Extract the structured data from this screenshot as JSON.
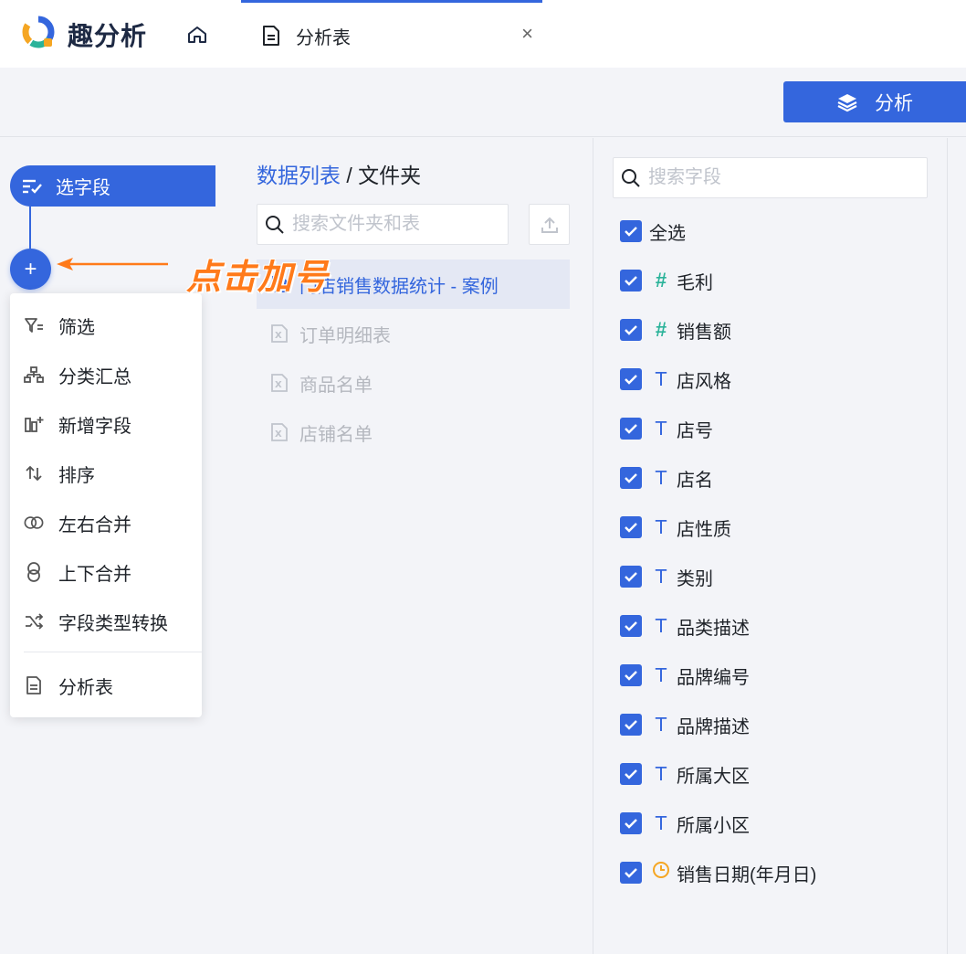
{
  "app": {
    "brand_name": "趣分析",
    "tab_label": "分析表",
    "tab_close": "×"
  },
  "toolbar": {
    "analyze_label": "分析"
  },
  "steps": {
    "select_field_label": "选字段",
    "plus_label": "+",
    "hint_text": "点击加号"
  },
  "menu": {
    "items": [
      {
        "label": "筛选",
        "icon": "filter-icon"
      },
      {
        "label": "分类汇总",
        "icon": "hierarchy-icon"
      },
      {
        "label": "新增字段",
        "icon": "add-column-icon"
      },
      {
        "label": "排序",
        "icon": "sort-icon"
      },
      {
        "label": "左右合并",
        "icon": "horizontal-merge-icon"
      },
      {
        "label": "上下合并",
        "icon": "vertical-merge-icon"
      },
      {
        "label": "字段类型转换",
        "icon": "shuffle-icon"
      }
    ],
    "bottom_item": {
      "label": "分析表",
      "icon": "document-icon"
    }
  },
  "datalist": {
    "breadcrumb_link": "数据列表",
    "breadcrumb_sep": " / ",
    "breadcrumb_current": "文件夹",
    "search_placeholder": "搜索文件夹和表",
    "files": [
      {
        "name": "门店销售数据统计 - 案例",
        "active": true
      },
      {
        "name": "订单明细表",
        "active": false
      },
      {
        "name": "商品名单",
        "active": false
      },
      {
        "name": "店铺名单",
        "active": false
      }
    ]
  },
  "fields": {
    "search_placeholder": "搜索字段",
    "select_all_label": "全选",
    "items": [
      {
        "name": "毛利",
        "type": "number",
        "type_glyph": "#",
        "checked": true
      },
      {
        "name": "销售额",
        "type": "number",
        "type_glyph": "#",
        "checked": true
      },
      {
        "name": "店风格",
        "type": "text",
        "type_glyph": "T",
        "checked": true
      },
      {
        "name": "店号",
        "type": "text",
        "type_glyph": "T",
        "checked": true
      },
      {
        "name": "店名",
        "type": "text",
        "type_glyph": "T",
        "checked": true
      },
      {
        "name": "店性质",
        "type": "text",
        "type_glyph": "T",
        "checked": true
      },
      {
        "name": "类别",
        "type": "text",
        "type_glyph": "T",
        "checked": true
      },
      {
        "name": "品类描述",
        "type": "text",
        "type_glyph": "T",
        "checked": true
      },
      {
        "name": "品牌编号",
        "type": "text",
        "type_glyph": "T",
        "checked": true
      },
      {
        "name": "品牌描述",
        "type": "text",
        "type_glyph": "T",
        "checked": true
      },
      {
        "name": "所属大区",
        "type": "text",
        "type_glyph": "T",
        "checked": true
      },
      {
        "name": "所属小区",
        "type": "text",
        "type_glyph": "T",
        "checked": true
      },
      {
        "name": "销售日期(年月日)",
        "type": "date",
        "type_glyph": "clock",
        "checked": true
      }
    ]
  },
  "colors": {
    "accent": "#3466dd",
    "hint": "#ff7a1a",
    "number_type": "#2bb39a",
    "date_type": "#f5a623"
  }
}
